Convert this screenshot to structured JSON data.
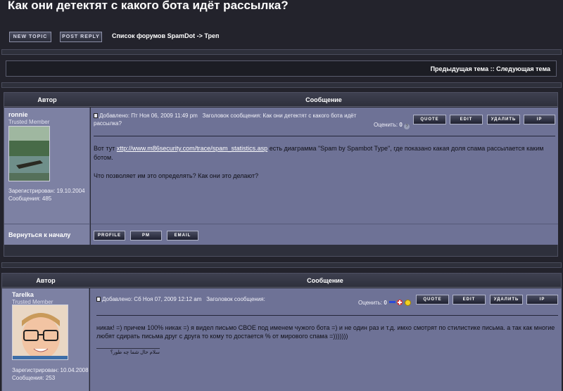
{
  "page": {
    "title": "Как они детектят с какого бота идёт рассылка?"
  },
  "toolbar": {
    "new_topic": "NEW TOPIC",
    "post_reply": "POST REPLY"
  },
  "breadcrumb": "Список форумов SpamDot -> Треп",
  "nav": {
    "links": "Предыдущая тема :: Следующая тема"
  },
  "table": {
    "author_header": "Автор",
    "message_header": "Сообщение"
  },
  "buttons": {
    "quote": "QUOTE",
    "edit": "EDIT",
    "delete": "УДАЛИТЬ",
    "ip": "IP",
    "profile": "PROFILE",
    "pm": "PM",
    "email": "EMAIL"
  },
  "posts": [
    {
      "author": "ronnie",
      "rank": "Trusted Member",
      "registered": "Зарегистрирован: 19.10.2004",
      "messages": "Сообщения: 485",
      "posted": "Добавлено: Пт Ноя 06, 2009 11:49 pm",
      "subject_line": "Заголовок сообщения: Как они детектят с какого бота идёт рассылка?",
      "rating_label": "Оценить:",
      "rating_value": "0",
      "body_prefix": "Вот тут ",
      "body_link": "xttp://www.m86security.com/trace/spam_statistics.asp",
      "body_suffix": " есть диаграмма \"Spam by Spambot Type\", где показано какая доля спама рассылается каким ботом.",
      "body_question": "Что позволяет им это определять? Как они это делают?",
      "back_to_top": "Вернуться к началу"
    },
    {
      "author": "Tarelka",
      "rank": "Trusted Member",
      "registered": "Зарегистрирован: 10.04.2008",
      "messages": "Сообщения: 253",
      "posted": "Добавлено: Сб Ноя 07, 2009 12:12 am",
      "subject_line": "Заголовок сообщения:",
      "rating_label": "Оценить:",
      "rating_value": "0",
      "body": "никак! =) причем 100% никак =) я видел письмо СВОЕ под именем чужого бота =) и не один раз и т.д. имхо смотрят по стилистике письма. а так как многие любят сдирать письма друг с друга то кому то достается % от мирового спама =)))))))",
      "signature": "سلام حال شما چه طور؟"
    }
  ]
}
